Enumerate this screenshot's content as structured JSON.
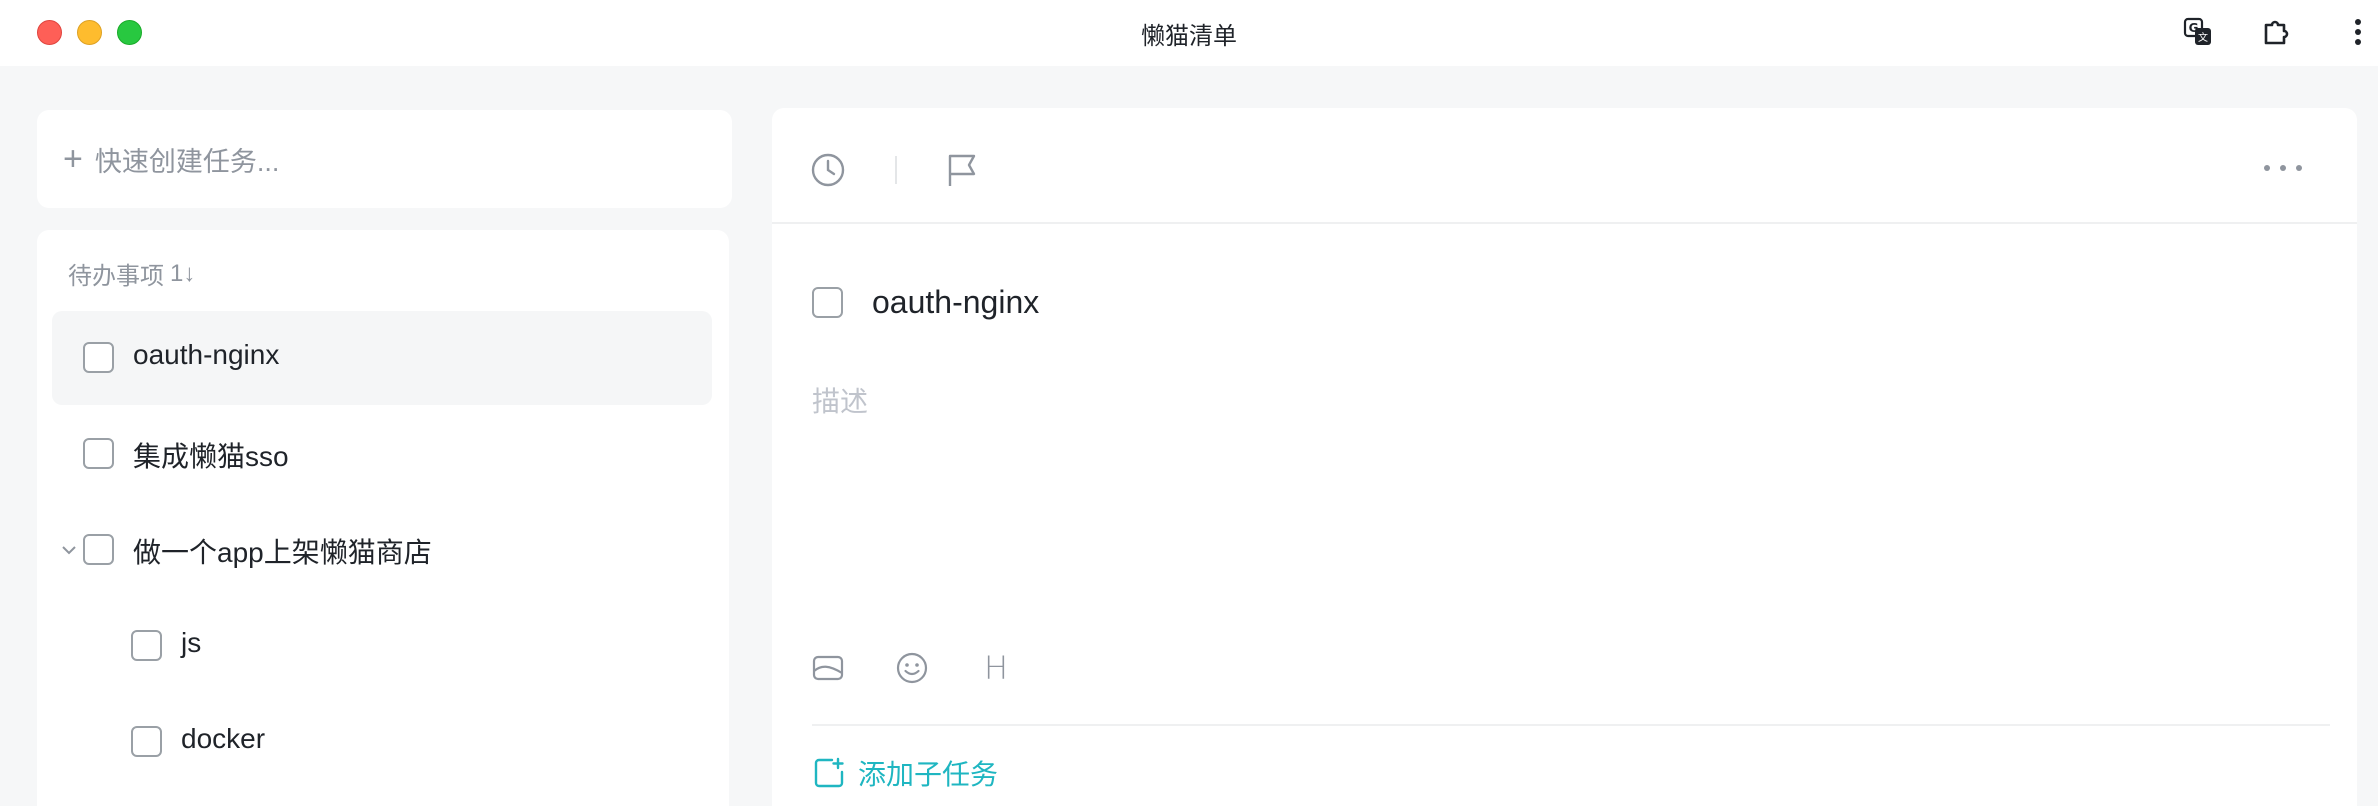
{
  "window": {
    "title": "懒猫清单"
  },
  "icons": {
    "translate": "translate-icon",
    "extension": "puzzle-extension-icon",
    "menu": "vertical-dots-icon",
    "clock": "clock-icon",
    "flag": "flag-icon",
    "more": "horizontal-dots-icon",
    "image": "image-icon",
    "emoji": "emoji-icon",
    "heading": "heading-icon",
    "add_subtask": "add-subtask-icon",
    "chevron": "chevron-down-icon"
  },
  "quick_create": {
    "plus": "+",
    "placeholder": "快速创建任务..."
  },
  "todo_section": {
    "title": "待办事项",
    "sort_indicator": "1↓",
    "tasks": [
      {
        "label": "oauth-nginx",
        "selected": true,
        "checked": false
      },
      {
        "label": "集成懒猫sso",
        "checked": false
      },
      {
        "label": "做一个app上架懒猫商店",
        "expanded": true,
        "checked": false,
        "subtasks": [
          {
            "label": "js",
            "checked": false
          },
          {
            "label": "docker",
            "checked": false
          }
        ]
      }
    ]
  },
  "detail": {
    "title": "oauth-nginx",
    "description_placeholder": "描述",
    "heading_glyph": "H",
    "add_subtask_label": "添加子任务"
  },
  "colors": {
    "accent": "#1fb6c1",
    "muted": "#8f959e",
    "background": "#f6f7f8"
  }
}
